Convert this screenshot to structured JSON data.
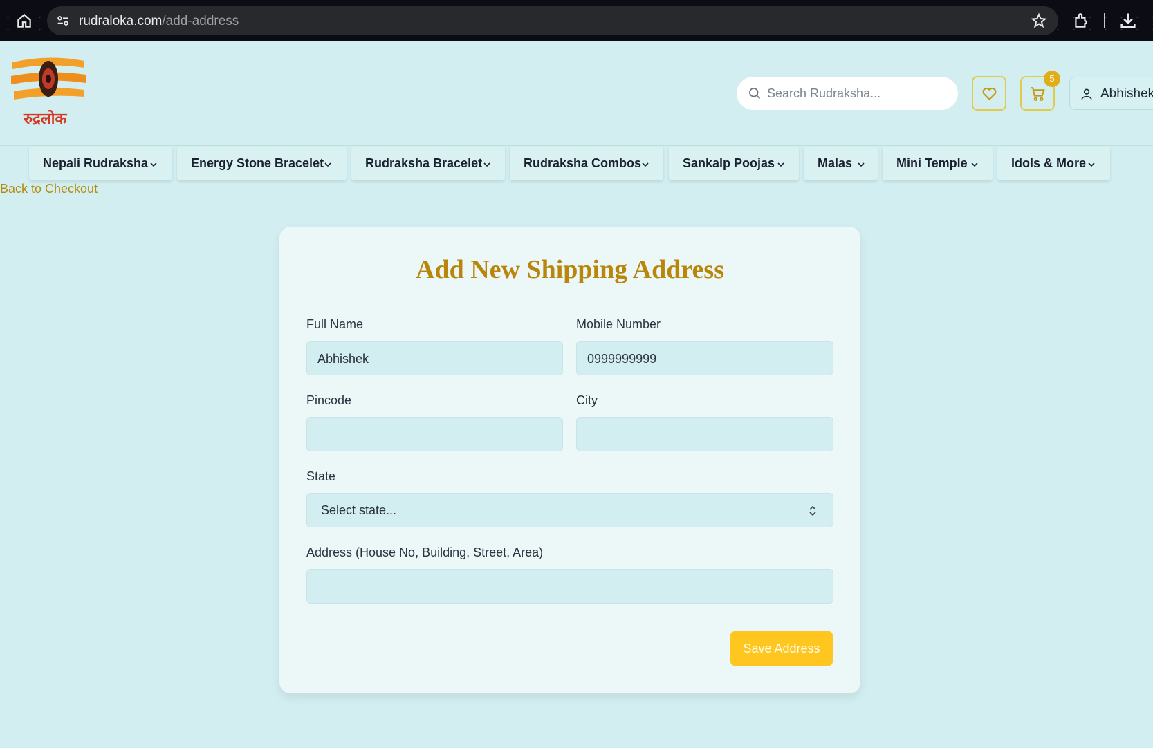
{
  "browser": {
    "url_domain": "rudraloka.com",
    "url_path": "/add-address"
  },
  "header": {
    "logo_text": "रुद्रलोक",
    "search_placeholder": "Search Rudraksha...",
    "cart_count": "5",
    "user_name": "Abhishek"
  },
  "nav": {
    "items": [
      {
        "label": "Nepali Rudraksha"
      },
      {
        "label": "Energy Stone Bracelet"
      },
      {
        "label": "Rudraksha Bracelet"
      },
      {
        "label": "Rudraksha Combos"
      },
      {
        "label": "Sankalp Poojas"
      },
      {
        "label": "Malas"
      },
      {
        "label": "Mini Temple"
      },
      {
        "label": "Idols & More"
      }
    ]
  },
  "back_link": "Back to Checkout",
  "form": {
    "title": "Add New Shipping Address",
    "full_name": {
      "label": "Full Name",
      "value": "Abhishek"
    },
    "mobile": {
      "label": "Mobile Number",
      "value": "0999999999"
    },
    "pincode": {
      "label": "Pincode",
      "value": ""
    },
    "city": {
      "label": "City",
      "value": ""
    },
    "state": {
      "label": "State",
      "selected": "Select state..."
    },
    "address": {
      "label": "Address (House No, Building, Street, Area)",
      "value": ""
    },
    "save_label": "Save Address"
  },
  "colors": {
    "page_bg": "#d2eef0",
    "accent_gold": "#b8860b",
    "button_yellow": "#ffc61f",
    "badge": "#e1ae17"
  },
  "icons": [
    "home-icon",
    "site-info-icon",
    "star-icon",
    "extensions-icon",
    "download-icon",
    "search-icon",
    "heart-icon",
    "cart-icon",
    "user-icon",
    "chevron-down-icon",
    "select-updown-icon"
  ]
}
